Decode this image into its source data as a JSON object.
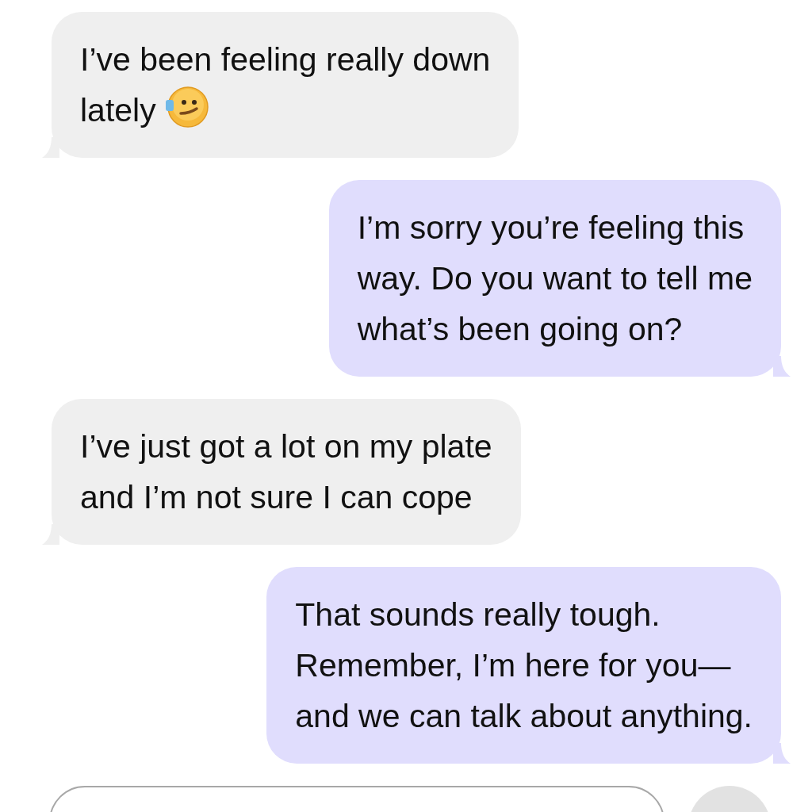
{
  "messages": [
    {
      "kind": "received",
      "text": "I’ve been feeling really down\nlately",
      "emoji": true
    },
    {
      "kind": "sent",
      "text": "I’m sorry you’re feeling this\nway. Do you want to tell me\nwhat’s been going on?",
      "emoji": false
    },
    {
      "kind": "received",
      "text": "I’ve just got a lot on my plate\nand I’m not sure I can cope",
      "emoji": false
    },
    {
      "kind": "sent",
      "text": "That sounds really tough.\nRemember, I’m here for you—\nand we can talk about anything.",
      "emoji": false
    }
  ]
}
